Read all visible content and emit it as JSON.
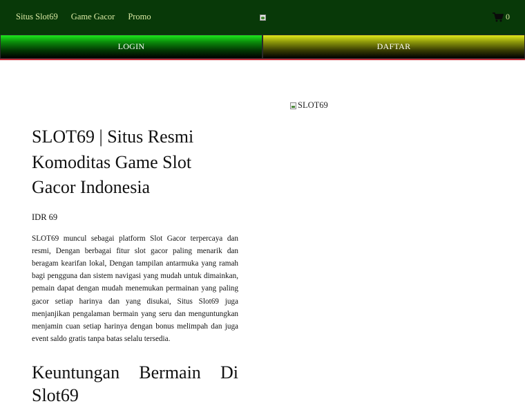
{
  "header": {
    "nav": [
      "Situs Slot69",
      "Game Gacor",
      "Promo"
    ],
    "cart_count": "0",
    "logo_icon": "broken-image-icon",
    "cart_icon": "shopping-cart-icon"
  },
  "buttons": {
    "login": "LOGIN",
    "daftar": "DAFTAR"
  },
  "hero": {
    "image_alt": "SLOT69"
  },
  "product": {
    "title": "SLOT69 | Situs Resmi Komoditas Game Slot Gacor Indonesia",
    "price": "IDR 69",
    "description": "SLOT69 muncul sebagai platform Slot Gacor terpercaya dan resmi, Dengan berbagai fitur slot gacor paling menarik dan beragam kearifan lokal, Dengan tampilan antarmuka yang ramah bagi pengguna dan sistem navigasi yang mudah untuk dimainkan, pemain dapat dengan mudah menemukan permainan yang paling gacor setiap harinya dan yang disukai, Situs Slot69 juga menjanjikan pengalaman bermain yang seru dan menguntungkan menjamin cuan setiap harinya dengan bonus melimpah dan juga event saldo gratis tanpa batas selalu tersedia.",
    "section_heading_words": [
      "Keuntungan",
      "Bermain",
      "Di"
    ],
    "section_heading_tail": "Slot69"
  },
  "colors": {
    "topbar": "#083908",
    "nav_text": "#d9e8a3",
    "login_green": "#1ce81c",
    "daftar_yellow": "#e0ea1a",
    "divider_red": "#c52f3a"
  }
}
